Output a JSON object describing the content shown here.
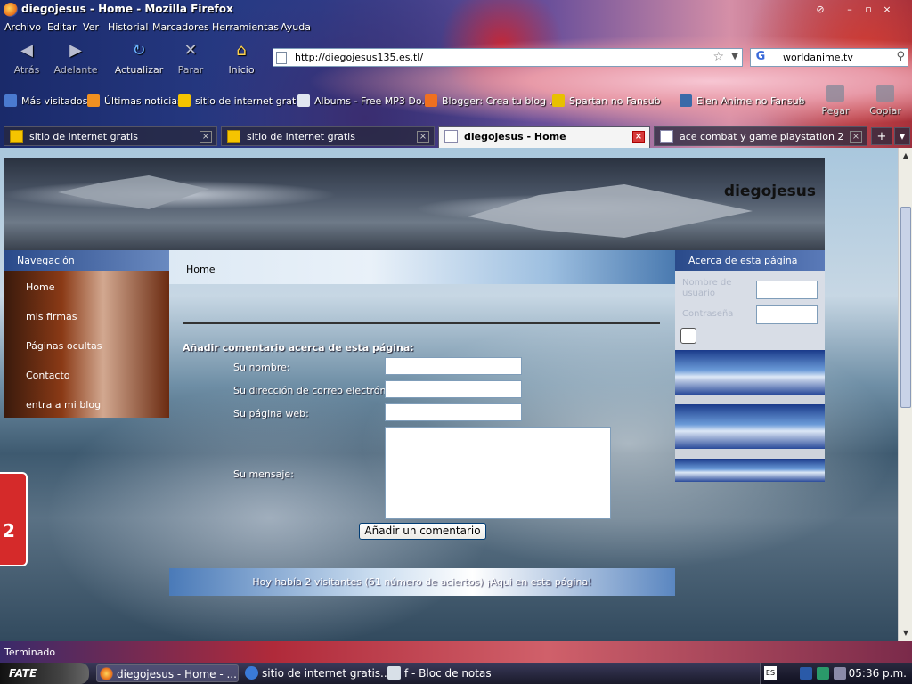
{
  "window": {
    "title": "diegojesus - Home - Mozilla Firefox"
  },
  "menu": [
    "Archivo",
    "Editar",
    "Ver",
    "Historial",
    "Marcadores",
    "Herramientas",
    "Ayuda"
  ],
  "nav": {
    "back": "Atrás",
    "forward": "Adelante",
    "reload": "Actualizar",
    "stop": "Parar",
    "home": "Inicio",
    "back_icon": "back-arrow-icon",
    "forward_icon": "forward-arrow-icon",
    "reload_icon": "reload-icon",
    "stop_icon": "stop-icon",
    "home_icon": "home-icon"
  },
  "address": {
    "url": "http://diegojesus135.es.tl/"
  },
  "search": {
    "value": "worldanime.tv"
  },
  "bookmarks": [
    {
      "label": "Más visitados",
      "icon": "most-visited-icon",
      "color": "#4a7ad0"
    },
    {
      "label": "Últimas noticias",
      "icon": "rss-icon",
      "color": "#f09020"
    },
    {
      "label": "sitio de internet gratis",
      "icon": "folder-icon",
      "color": "#f5c400"
    },
    {
      "label": "Albums - Free MP3 Do...",
      "icon": "page-icon",
      "color": "#e0e6f0"
    },
    {
      "label": "Blogger: Crea tu blog ...",
      "icon": "blogger-icon",
      "color": "#f07020"
    },
    {
      "label": "Spartan no Fansub",
      "icon": "site-icon",
      "color": "#e8c000"
    },
    {
      "label": "Elen Anime no Fansub",
      "icon": "wordpress-icon",
      "color": "#3a6aa8"
    }
  ],
  "toolbar_right": {
    "paste": "Pegar",
    "copy": "Copiar"
  },
  "tabs": [
    {
      "title": "sitio de internet gratis",
      "active": false
    },
    {
      "title": "sitio de internet gratis",
      "active": false
    },
    {
      "title": "diegojesus - Home",
      "active": true
    },
    {
      "title": "ace combat y game playstation 2",
      "active": false
    }
  ],
  "page": {
    "site_name": "diegojesus",
    "nav_header": "Navegación",
    "nav_items": [
      "Home",
      "mis firmas",
      "Páginas ocultas",
      "Contacto",
      "entra a mi blog"
    ],
    "breadcrumb": "Home",
    "form": {
      "title": "Añadir comentario acerca de esta página:",
      "name_label": "Su nombre:",
      "email_label": "Su dirección de correo electrónico:",
      "web_label": "Su página web:",
      "message_label": "Su mensaje:",
      "submit": "Añadir un comentario"
    },
    "counter_text": "Hoy había 2 visitantes (61 número de aciertos) ¡Aqui en esta página!",
    "right_header": "Acerca de esta página",
    "login": {
      "user_label": "Nombre de usuario",
      "pass_label": "Contraseña"
    },
    "side_widget_number": "2"
  },
  "status": {
    "text": "Terminado"
  },
  "taskbar": {
    "start_label": "FATE",
    "tasks": [
      {
        "label": "diegojesus - Home - ...",
        "icon": "firefox-icon",
        "active": true
      },
      {
        "label": "sitio de internet gratis...",
        "icon": "ie-icon",
        "active": false
      },
      {
        "label": "f - Bloc de notas",
        "icon": "notepad-icon",
        "active": false
      }
    ],
    "lang": "ES",
    "clock": "05:36 p.m."
  }
}
